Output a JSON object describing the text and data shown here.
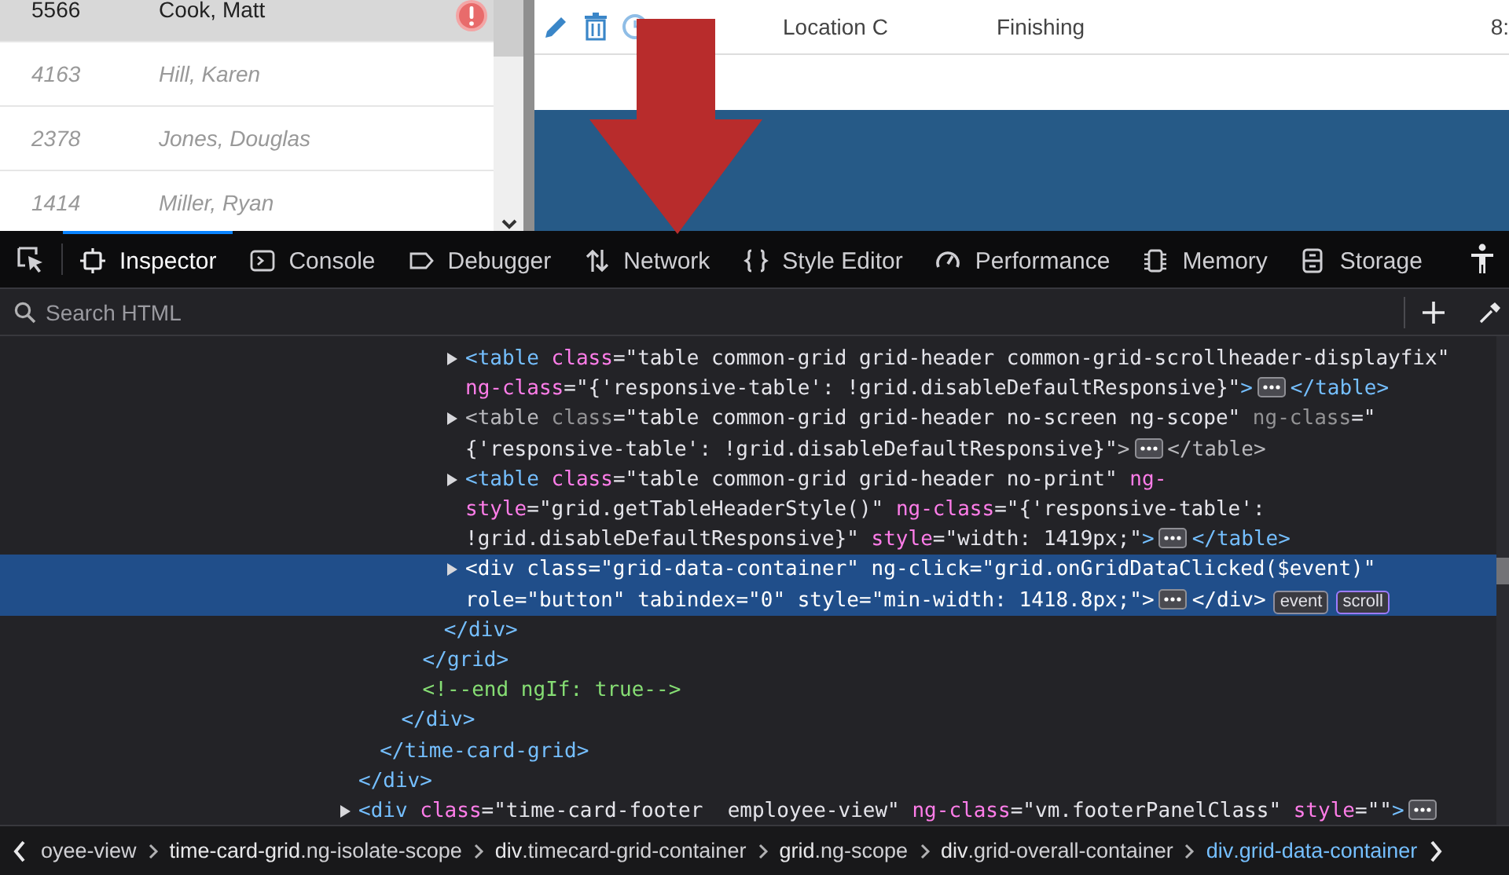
{
  "app_grid": {
    "rows": [
      {
        "id": "5566",
        "name": "Cook, Matt",
        "selected": true,
        "flagged": true
      },
      {
        "id": "4163",
        "name": "Hill, Karen",
        "selected": false,
        "flagged": false
      },
      {
        "id": "2378",
        "name": "Jones, Douglas",
        "selected": false,
        "flagged": false
      },
      {
        "id": "1414",
        "name": "Miller, Ryan",
        "selected": false,
        "flagged": false
      }
    ]
  },
  "detail_row": {
    "location": "Location C",
    "operation": "Finishing",
    "column_5": "8:"
  },
  "devtools": {
    "tabs": [
      {
        "label": "Inspector",
        "selected": true
      },
      {
        "label": "Console",
        "selected": false
      },
      {
        "label": "Debugger",
        "selected": false
      },
      {
        "label": "Network",
        "selected": false
      },
      {
        "label": "Style Editor",
        "selected": false
      },
      {
        "label": "Performance",
        "selected": false
      },
      {
        "label": "Memory",
        "selected": false
      },
      {
        "label": "Storage",
        "selected": false
      }
    ],
    "search": {
      "placeholder": "Search HTML"
    },
    "markup": {
      "nodes": [
        {
          "children": [
            {
              "children": [
                {
                  "children": [
                    {
                      "children": [
                        {
                          "children": [
                            {
                              "expanded": false,
                              "selected": false,
                              "dimmed": false,
                              "open": [
                                {
                                  "kind": "tag",
                                  "text": "<table"
                                },
                                {
                                  "kind": "attr",
                                  "text": " class"
                                },
                                {
                                  "kind": "value",
                                  "text": "=\"table common-grid grid-header common-grid-scrollheader-displayfix\""
                                },
                                {
                                  "kind": "attr",
                                  "text": " ng-class"
                                },
                                {
                                  "kind": "value",
                                  "text": "=\"{'responsive-table': !grid.disableDefaultResponsive}\""
                                },
                                {
                                  "kind": "tag",
                                  "text": ">"
                                },
                                {
                                  "kind": "more"
                                },
                                {
                                  "kind": "tag",
                                  "text": "</table>"
                                }
                              ]
                            },
                            {
                              "expanded": false,
                              "selected": false,
                              "dimmed": true,
                              "open": [
                                {
                                  "kind": "tag",
                                  "text": "<table"
                                },
                                {
                                  "kind": "attr",
                                  "text": " class"
                                },
                                {
                                  "kind": "value",
                                  "text": "=\"table common-grid grid-header no-screen ng-scope\""
                                },
                                {
                                  "kind": "attr",
                                  "text": " ng-class"
                                },
                                {
                                  "kind": "value",
                                  "text": "=\" {'responsive-table': !grid.disableDefaultResponsive}\""
                                },
                                {
                                  "kind": "tag",
                                  "text": ">"
                                },
                                {
                                  "kind": "more"
                                },
                                {
                                  "kind": "tag",
                                  "text": "</table>"
                                }
                              ]
                            },
                            {
                              "expanded": false,
                              "selected": false,
                              "dimmed": false,
                              "open": [
                                {
                                  "kind": "tag",
                                  "text": "<table"
                                },
                                {
                                  "kind": "attr",
                                  "text": " class"
                                },
                                {
                                  "kind": "value",
                                  "text": "=\"table common-grid grid-header no-print\""
                                },
                                {
                                  "kind": "attr",
                                  "text": " ng-style"
                                },
                                {
                                  "kind": "value",
                                  "text": "=\"grid.getTableHeaderStyle()\""
                                },
                                {
                                  "kind": "attr",
                                  "text": " ng-class"
                                },
                                {
                                  "kind": "value",
                                  "text": "=\"{'responsive-table': !grid.disableDefaultResponsive}\""
                                },
                                {
                                  "kind": "attr",
                                  "text": " style"
                                },
                                {
                                  "kind": "value",
                                  "text": "=\"width: 1419px;\""
                                },
                                {
                                  "kind": "tag",
                                  "text": ">"
                                },
                                {
                                  "kind": "more"
                                },
                                {
                                  "kind": "tag",
                                  "text": "</table>"
                                }
                              ]
                            },
                            {
                              "expanded": false,
                              "selected": true,
                              "dimmed": false,
                              "open": [
                                {
                                  "kind": "tag",
                                  "text": "<div"
                                },
                                {
                                  "kind": "attr",
                                  "text": " class"
                                },
                                {
                                  "kind": "value",
                                  "text": "=\"grid-data-container\""
                                },
                                {
                                  "kind": "attr",
                                  "text": " ng-click"
                                },
                                {
                                  "kind": "value",
                                  "text": "=\"grid.onGridDataClicked($event)\""
                                },
                                {
                                  "kind": "attr",
                                  "text": " role"
                                },
                                {
                                  "kind": "value",
                                  "text": "=\"button\""
                                },
                                {
                                  "kind": "attr",
                                  "text": " tabindex"
                                },
                                {
                                  "kind": "value",
                                  "text": "=\"0\""
                                },
                                {
                                  "kind": "attr",
                                  "text": " style"
                                },
                                {
                                  "kind": "value",
                                  "text": "=\"min-width: 1418.8px;\""
                                },
                                {
                                  "kind": "tag",
                                  "text": ">"
                                },
                                {
                                  "kind": "more"
                                },
                                {
                                  "kind": "tag",
                                  "text": "</div>"
                                },
                                {
                                  "kind": "badge",
                                  "text": "event",
                                  "color": "#8f8f9d"
                                },
                                {
                                  "kind": "badge",
                                  "text": "scroll",
                                  "color": "#9e7bff"
                                }
                              ]
                            }
                          ],
                          "close": [
                            {
                              "kind": "tag",
                              "text": "</div>"
                            }
                          ]
                        }
                      ],
                      "close": [
                        {
                          "kind": "tag",
                          "text": "</grid>"
                        }
                      ]
                    },
                    {
                      "open": [
                        {
                          "kind": "comment",
                          "text": "<!--end ngIf: true-->"
                        }
                      ]
                    }
                  ],
                  "close": [
                    {
                      "kind": "tag",
                      "text": "</div>"
                    }
                  ]
                }
              ],
              "close": [
                {
                  "kind": "tag",
                  "text": "</time-card-grid>"
                }
              ]
            }
          ],
          "close": [
            {
              "kind": "tag",
              "text": "</div>"
            }
          ]
        },
        {
          "expanded": false,
          "selected": false,
          "dimmed": false,
          "open": [
            {
              "kind": "tag",
              "text": "<div"
            },
            {
              "kind": "attr",
              "text": " class"
            },
            {
              "kind": "value",
              "text": "=\"time-card-footer  employee-view\""
            },
            {
              "kind": "attr",
              "text": " ng-class"
            },
            {
              "kind": "value",
              "text": "=\"vm.footerPanelClass\""
            },
            {
              "kind": "attr",
              "text": " style"
            },
            {
              "kind": "value",
              "text": "=\"\""
            },
            {
              "kind": "tag",
              "text": ">"
            },
            {
              "kind": "more"
            }
          ]
        }
      ]
    },
    "breadcrumbs": [
      {
        "class_part": "oyee-view",
        "selected": false
      },
      {
        "tag": "time-card-grid",
        "class_part": ".ng-isolate-scope",
        "selected": false
      },
      {
        "tag": "div",
        "class_part": ".timecard-grid-container",
        "selected": false
      },
      {
        "tag": "grid",
        "class_part": ".ng-scope",
        "selected": false
      },
      {
        "tag": "div",
        "class_part": ".grid-overall-container",
        "selected": false
      },
      {
        "tag": "div",
        "class_part": ".grid-data-container",
        "selected": true
      }
    ]
  }
}
